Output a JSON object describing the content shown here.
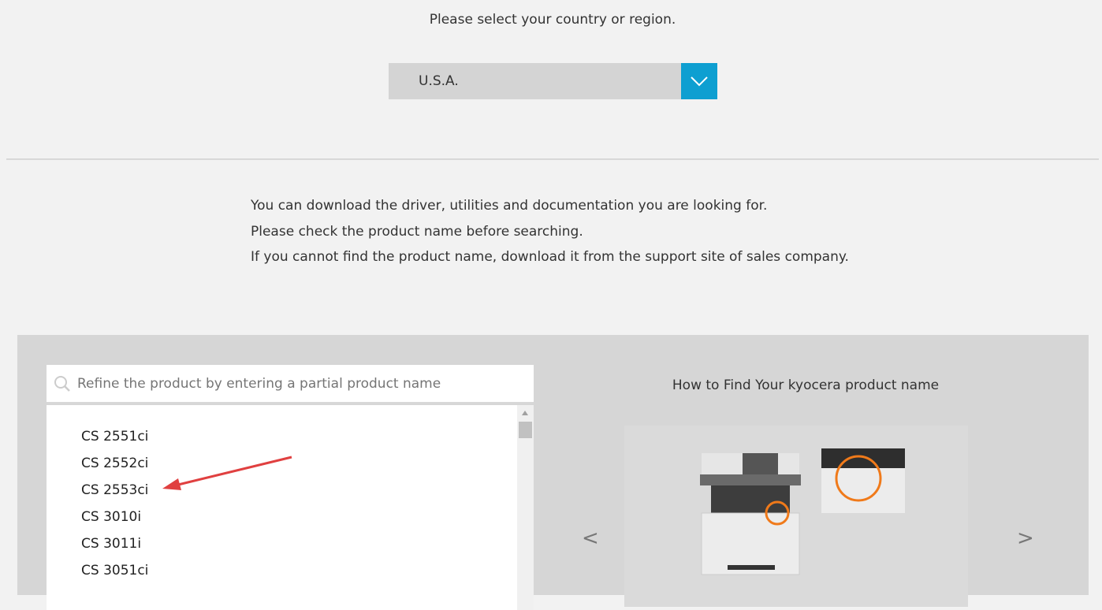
{
  "region": {
    "title": "Please select your country or region.",
    "selected": "U.S.A."
  },
  "intro": [
    "You can download the driver, utilities and documentation you are looking for.",
    "Please check the product name before searching.",
    "If you cannot find the product name, download it from the support site of sales company."
  ],
  "search": {
    "placeholder": "Refine the product by entering a partial product name",
    "value": ""
  },
  "products": [
    "CS 2551ci",
    "CS 2552ci",
    "CS 2553ci",
    "CS 3010i",
    "CS 3011i",
    "CS 3051ci"
  ],
  "howto": {
    "title": "How to Find Your kyocera product name",
    "prev": "<",
    "next": ">"
  },
  "colors": {
    "accent": "#0e9fd1",
    "highlight": "#f07a1a",
    "annotation": "#e04040"
  }
}
